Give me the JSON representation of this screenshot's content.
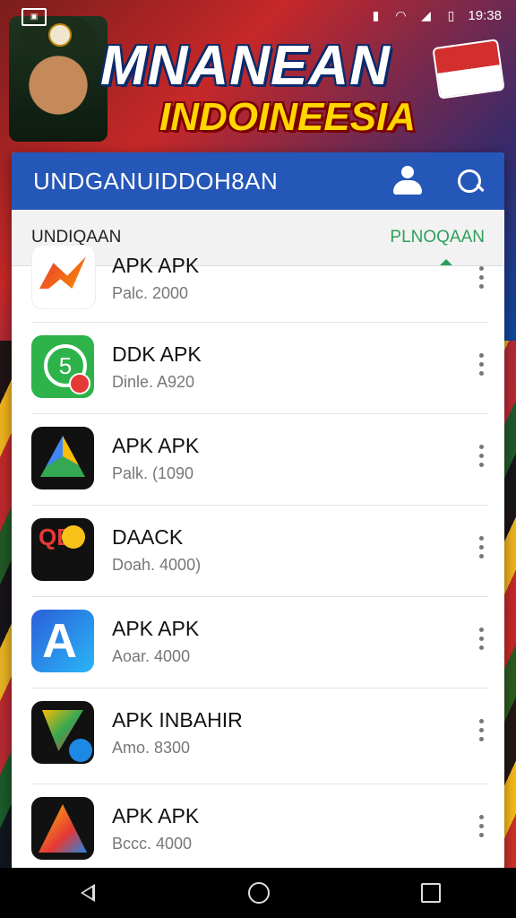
{
  "status_bar": {
    "time": "19:38",
    "left_icon": "notification-icon",
    "icons": [
      "sim-icon",
      "wifi-icon",
      "signal-icon",
      "battery-icon"
    ]
  },
  "banner": {
    "title": "MNANEAN",
    "subtitle": "INDOINEESIA"
  },
  "app_bar": {
    "title": "UNDGANUIDDOH8AN",
    "account_icon": "account-icon",
    "search_icon": "search-icon",
    "color": "#2557b8"
  },
  "tabs": [
    {
      "label": "UNDIQAAN",
      "active": false
    },
    {
      "label": "PLNOQAAN",
      "active": true
    }
  ],
  "accent_color": "#2e9e5b",
  "apps": [
    {
      "name": "APK APK",
      "meta": "Palc. 2000",
      "icon": "arrow-logo-icon"
    },
    {
      "name": "DDK APK",
      "meta": "Dinle. A920",
      "icon": "clock-logo-icon"
    },
    {
      "name": "APK APK",
      "meta": "Palk. (1090",
      "icon": "triangle-logo-icon"
    },
    {
      "name": "DAACK",
      "meta": "Doah. 4000)",
      "icon": "qb-logo-icon"
    },
    {
      "name": "APK APK",
      "meta": "Aoar. 4000",
      "icon": "a-logo-icon"
    },
    {
      "name": "APK INBAHIR",
      "meta": "Amo. 8300",
      "icon": "v-logo-icon"
    },
    {
      "name": "APK APK",
      "meta": "Bccc. 4000",
      "icon": "pyramid-logo-icon"
    }
  ],
  "nav": {
    "back_icon": "back-icon",
    "home_icon": "home-icon",
    "recents_icon": "recents-icon"
  }
}
